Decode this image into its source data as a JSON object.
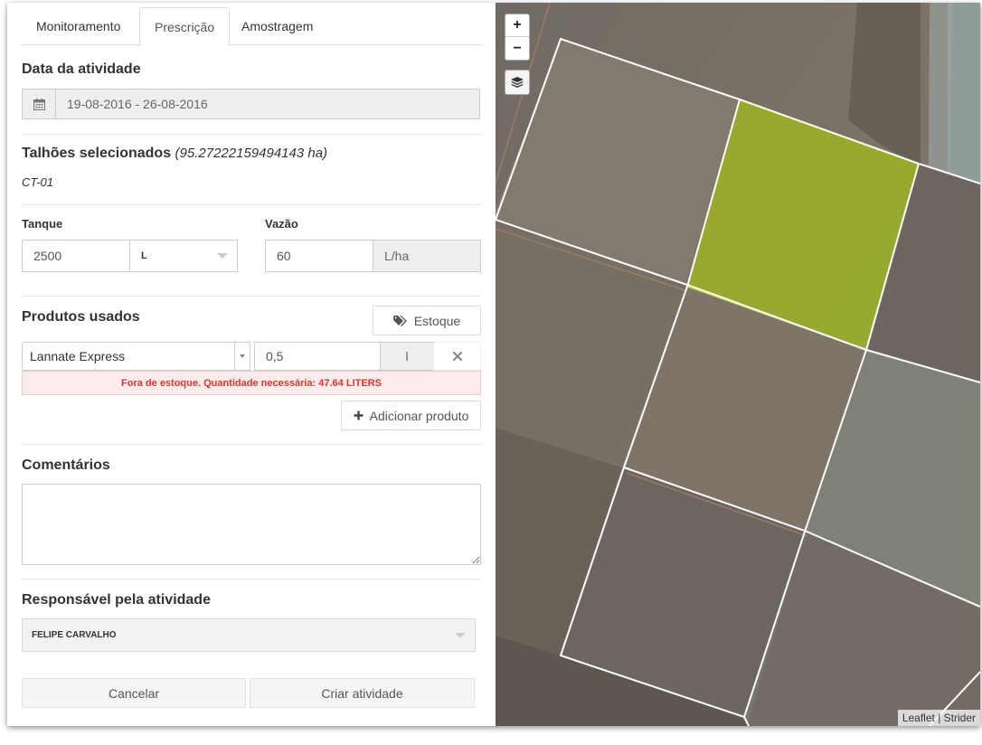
{
  "tabs": [
    "Monitoramento",
    "Prescrição",
    "Amostragem"
  ],
  "activity_date": {
    "heading": "Data da atividade",
    "value": "19-08-2016 - 26-08-2016"
  },
  "plots": {
    "heading": "Talhões selecionados",
    "area": "(95.27222159494143 ha)",
    "selected": "CT-01"
  },
  "tank": {
    "label": "Tanque",
    "value": "2500",
    "unit": "L"
  },
  "flow": {
    "label": "Vazão",
    "value": "60",
    "unit": "L/ha"
  },
  "products": {
    "heading": "Produtos usados",
    "stock_button": "Estoque",
    "items": [
      {
        "name": "Lannate Express",
        "quantity": "0,5",
        "unit": "l"
      }
    ],
    "error": "Fora de estoque. Quantidade necessária: 47.64 LITERS",
    "add_button": "Adicionar produto"
  },
  "comments": {
    "heading": "Comentários",
    "value": ""
  },
  "responsible": {
    "heading": "Responsável pela atividade",
    "value": "FELIPE CARVALHO"
  },
  "actions": {
    "cancel": "Cancelar",
    "create": "Criar atividade"
  },
  "map": {
    "zoom_in": "+",
    "zoom_out": "−",
    "attribution_leaflet": "Leaflet",
    "attribution_sep": "|",
    "attribution_strider": "Strider",
    "selected_color": "#9db324"
  },
  "icons": [
    "calendar-icon",
    "tags-icon",
    "plus-icon",
    "close-icon",
    "chevron-down-icon",
    "layers-icon"
  ]
}
